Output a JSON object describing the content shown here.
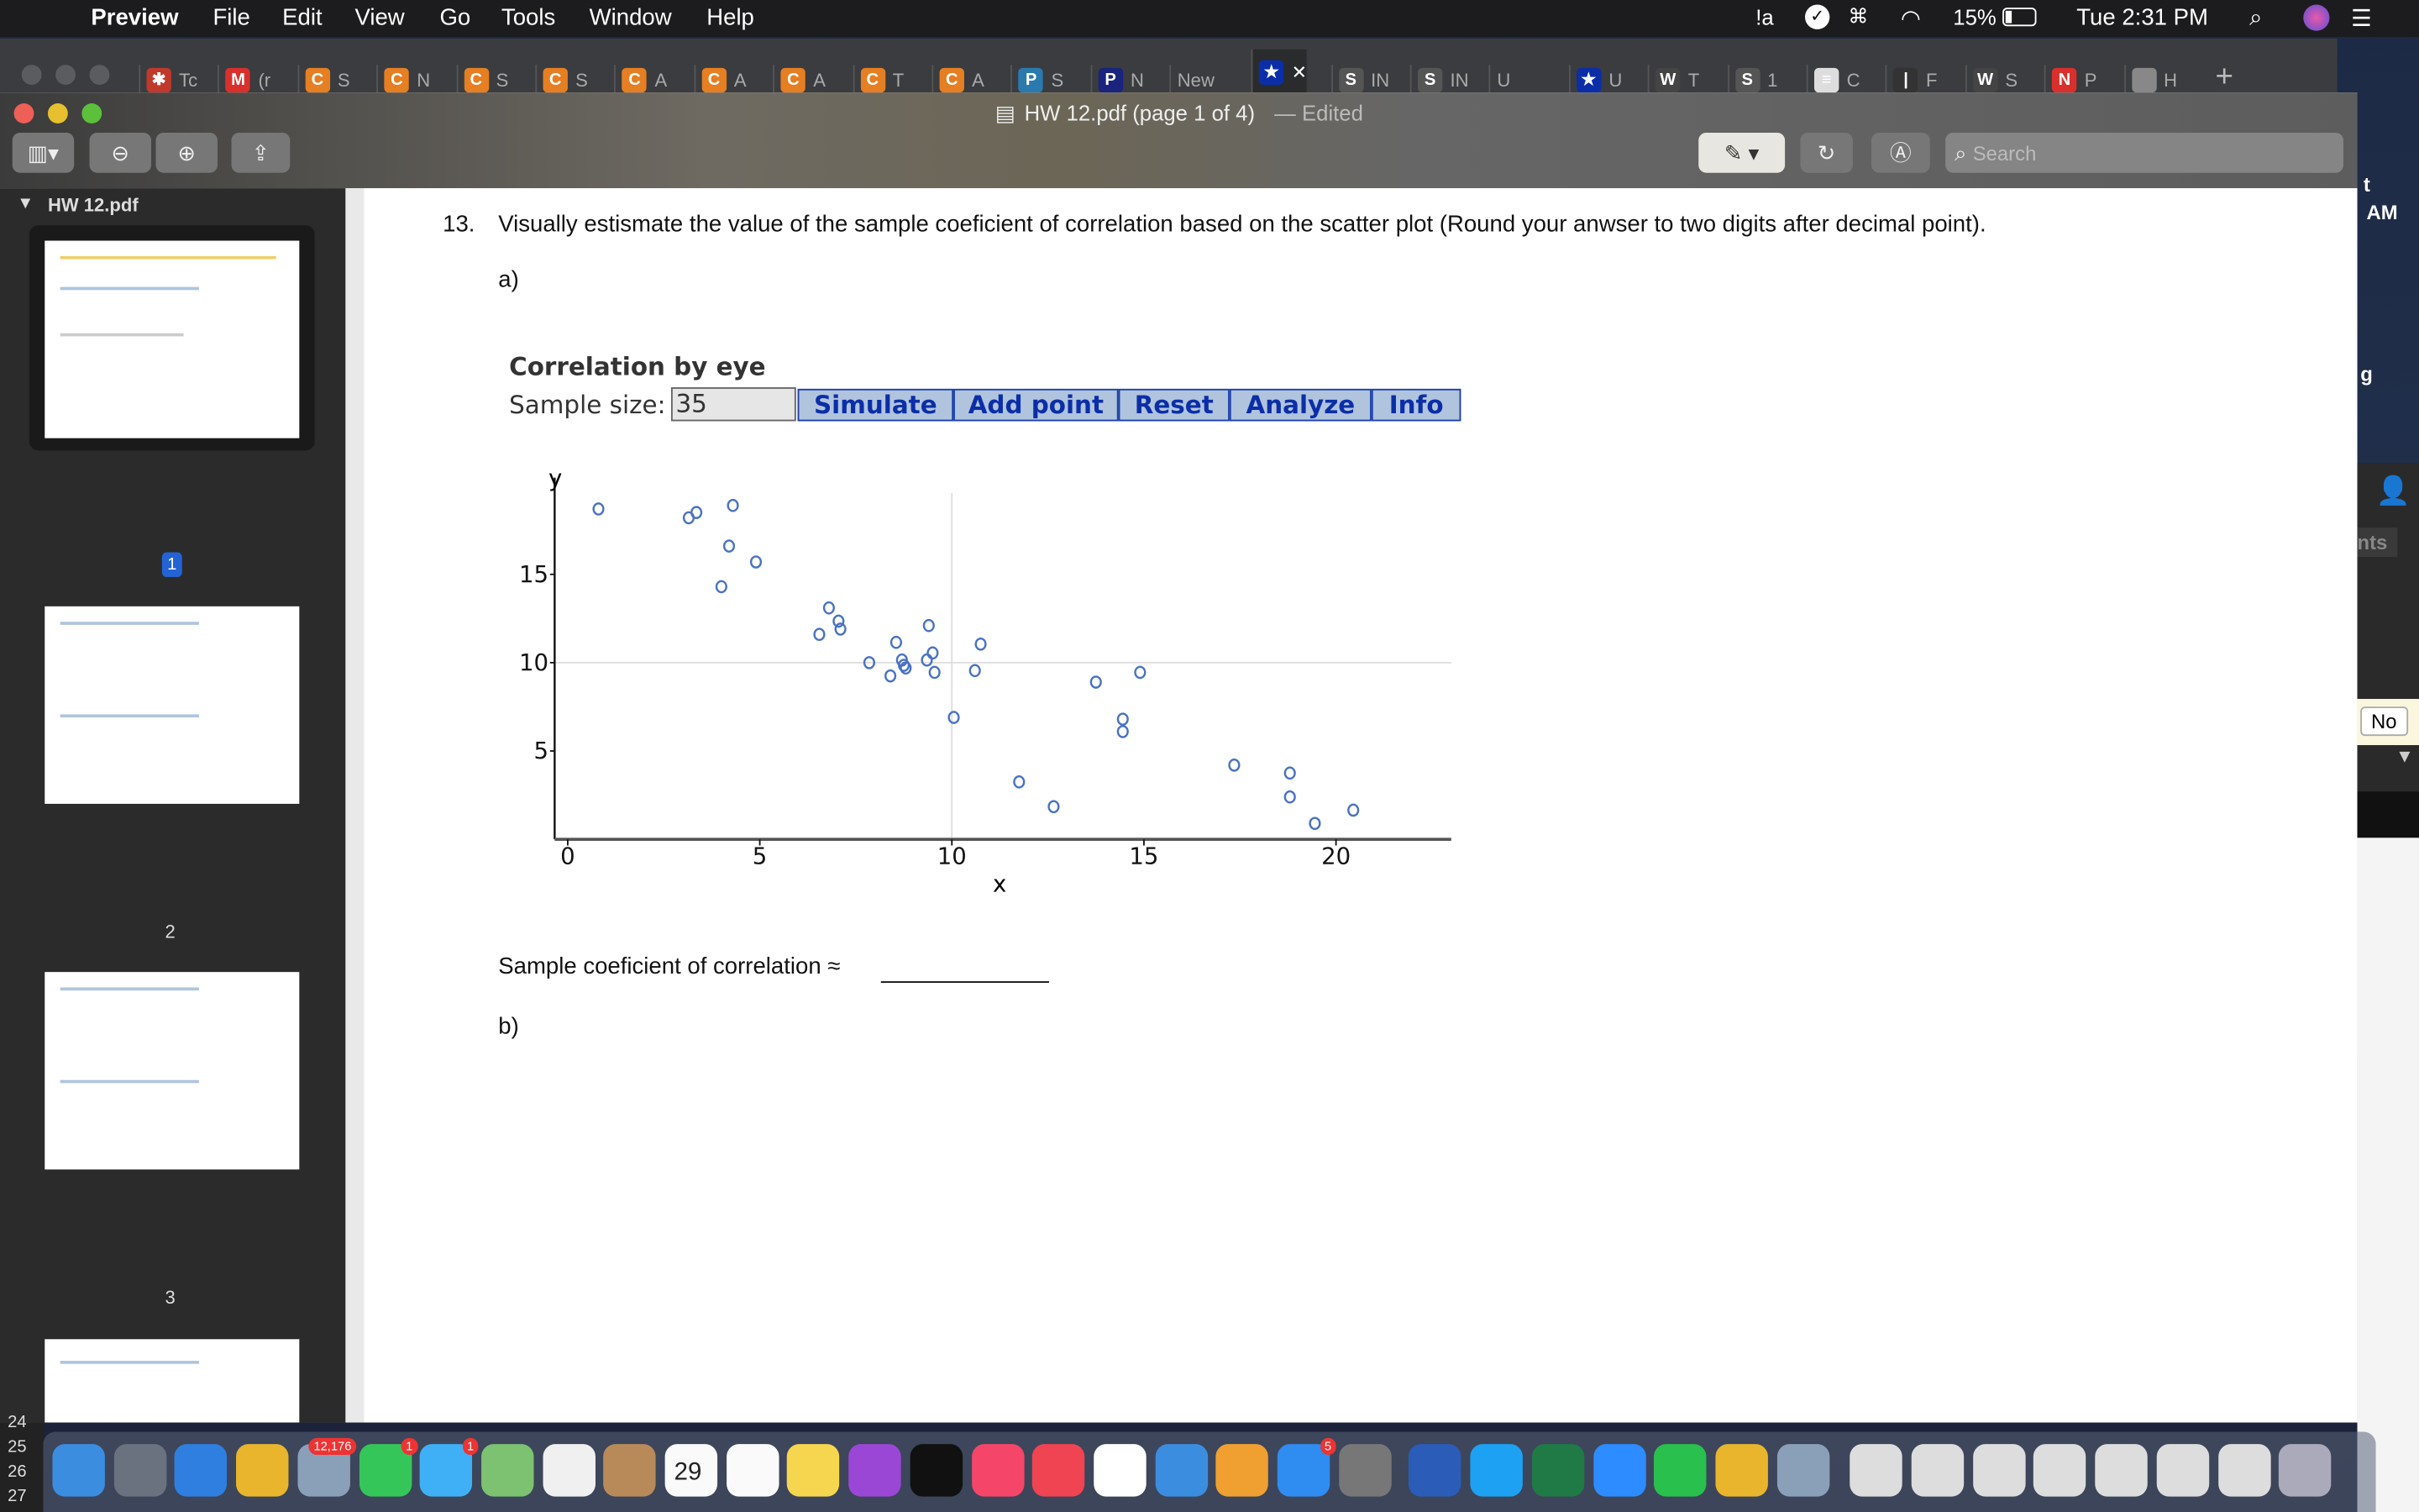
{
  "menubar": {
    "apple_icon": "apple-icon",
    "app": "Preview",
    "items": [
      "File",
      "Edit",
      "View",
      "Go",
      "Tools",
      "Window",
      "Help"
    ],
    "battery": "15%",
    "clock": "Tue 2:31 PM",
    "status_icons": [
      "avast-icon",
      "checkmark-icon",
      "command-icon",
      "wifi-icon",
      "battery-icon",
      "search-icon",
      "siri-icon",
      "list-icon"
    ]
  },
  "tabs": [
    {
      "label": "Tc",
      "color": "#c0392b",
      "glyph": "✱"
    },
    {
      "label": "(r",
      "color": "#d9302c",
      "glyph": "M"
    },
    {
      "label": "S",
      "color": "#e67e22",
      "glyph": "C"
    },
    {
      "label": "N",
      "color": "#e67e22",
      "glyph": "C"
    },
    {
      "label": "S",
      "color": "#e67e22",
      "glyph": "C"
    },
    {
      "label": "S",
      "color": "#e67e22",
      "glyph": "C"
    },
    {
      "label": "A",
      "color": "#e67e22",
      "glyph": "C"
    },
    {
      "label": "A",
      "color": "#e67e22",
      "glyph": "C"
    },
    {
      "label": "A",
      "color": "#e67e22",
      "glyph": "C"
    },
    {
      "label": "T",
      "color": "#e67e22",
      "glyph": "C"
    },
    {
      "label": "A",
      "color": "#e67e22",
      "glyph": "C"
    },
    {
      "label": "S",
      "color": "#2a7ab0",
      "glyph": "P"
    },
    {
      "label": "N",
      "color": "#1a237e",
      "glyph": "P"
    },
    {
      "label": "New",
      "color": "",
      "glyph": ""
    },
    {
      "label": "✕",
      "color": "#0b2ea8",
      "glyph": "★",
      "active": true
    },
    {
      "label": "IN",
      "color": "#555",
      "glyph": "S"
    },
    {
      "label": "IN",
      "color": "#555",
      "glyph": "S"
    },
    {
      "label": "U",
      "color": "",
      "glyph": ""
    },
    {
      "label": "U",
      "color": "#0b2ea8",
      "glyph": "★"
    },
    {
      "label": "T",
      "color": "#444",
      "glyph": "W"
    },
    {
      "label": "1",
      "color": "#555",
      "glyph": "S"
    },
    {
      "label": "C",
      "color": "#ddd",
      "glyph": "≡"
    },
    {
      "label": "F",
      "color": "#333",
      "glyph": "|"
    },
    {
      "label": "S",
      "color": "#444",
      "glyph": "W"
    },
    {
      "label": "P",
      "color": "#d9302c",
      "glyph": "N"
    },
    {
      "label": "H",
      "color": "#888",
      "glyph": ""
    }
  ],
  "window": {
    "title": "HW 12.pdf (page 1 of 4)",
    "edited": "— Edited",
    "search_placeholder": "Search"
  },
  "sidebar": {
    "file": "HW 12.pdf",
    "pages": [
      "1",
      "2",
      "3"
    ]
  },
  "doc": {
    "q_number": "13.",
    "question": "Visually estismate the value of the sample coeficient of correlation based on the scatter plot (Round your anwser to two digits after decimal point).",
    "part_a": "a)",
    "part_b": "b)",
    "widget_title": "Correlation by eye",
    "sample_label": "Sample size:",
    "sample_value": "35",
    "buttons": [
      "Simulate",
      "Add point",
      "Reset",
      "Analyze",
      "Info"
    ],
    "answer_label": "Sample coeficient of correlation ≈"
  },
  "chart_data": {
    "type": "scatter",
    "xlabel": "x",
    "ylabel": "y",
    "xticks": [
      0,
      5,
      10,
      15,
      20
    ],
    "yticks": [
      5,
      10,
      15
    ],
    "xlim": [
      -0.3,
      23
    ],
    "ylim": [
      0,
      19.6
    ],
    "reference_lines": {
      "x": 10,
      "y": 10
    },
    "marker": "open-circle",
    "color": "#4a72c4",
    "points": [
      [
        0.8,
        18.7
      ],
      [
        3.15,
        18.2
      ],
      [
        3.35,
        18.5
      ],
      [
        4.3,
        18.9
      ],
      [
        4.2,
        16.6
      ],
      [
        4.9,
        15.7
      ],
      [
        4.0,
        14.3
      ],
      [
        6.8,
        13.1
      ],
      [
        7.05,
        12.35
      ],
      [
        7.1,
        11.9
      ],
      [
        6.55,
        11.6
      ],
      [
        8.55,
        11.15
      ],
      [
        9.4,
        12.1
      ],
      [
        10.75,
        11.05
      ],
      [
        7.85,
        10.0
      ],
      [
        8.7,
        10.15
      ],
      [
        8.75,
        9.85
      ],
      [
        8.8,
        9.7
      ],
      [
        9.35,
        10.15
      ],
      [
        9.5,
        10.55
      ],
      [
        8.4,
        9.25
      ],
      [
        9.55,
        9.45
      ],
      [
        10.6,
        9.55
      ],
      [
        10.05,
        6.9
      ],
      [
        13.75,
        8.9
      ],
      [
        14.9,
        9.45
      ],
      [
        14.45,
        6.8
      ],
      [
        14.45,
        6.1
      ],
      [
        11.75,
        3.25
      ],
      [
        12.65,
        1.85
      ],
      [
        17.35,
        4.2
      ],
      [
        18.8,
        3.75
      ],
      [
        18.8,
        2.4
      ],
      [
        19.45,
        0.9
      ],
      [
        20.45,
        1.65
      ]
    ]
  },
  "right_edge": {
    "texts": [
      "t",
      "AM",
      "g",
      "nts",
      "No"
    ]
  },
  "sheet_rows": [
    "24",
    "25",
    "26",
    "27"
  ],
  "dock": [
    {
      "name": "finder",
      "color": "#3b8de0"
    },
    {
      "name": "launchpad",
      "color": "#6a7280"
    },
    {
      "name": "safari",
      "color": "#2f7fe0"
    },
    {
      "name": "chrome",
      "color": "#e8b52c"
    },
    {
      "name": "preview",
      "color": "#8aa0b8",
      "badge": "12,176"
    },
    {
      "name": "facetime",
      "color": "#35c659",
      "badge": "1"
    },
    {
      "name": "messages",
      "color": "#3fb0f5",
      "badge": "1"
    },
    {
      "name": "maps",
      "color": "#7cc270"
    },
    {
      "name": "photos",
      "color": "#f0f0f0"
    },
    {
      "name": "contacts",
      "color": "#b88a5a"
    },
    {
      "name": "calendar",
      "color": "#fafafa",
      "text": "29"
    },
    {
      "name": "reminders",
      "color": "#fafafa"
    },
    {
      "name": "notes",
      "color": "#f6d64e"
    },
    {
      "name": "podcasts",
      "color": "#9b47d6"
    },
    {
      "name": "tv",
      "color": "#111"
    },
    {
      "name": "music",
      "color": "#f5466a"
    },
    {
      "name": "news",
      "color": "#f04452"
    },
    {
      "name": "numbers",
      "color": "#fff"
    },
    {
      "name": "keynote",
      "color": "#3b8de0"
    },
    {
      "name": "pages",
      "color": "#f0a030"
    },
    {
      "name": "app-store",
      "color": "#2f8cf0",
      "badge": "5"
    },
    {
      "name": "system-preferences",
      "color": "#777"
    },
    {
      "name": "word",
      "color": "#2b5cb8"
    },
    {
      "name": "skype",
      "color": "#1da1f2"
    },
    {
      "name": "excel",
      "color": "#1f7a45"
    },
    {
      "name": "zoom",
      "color": "#2d8cff"
    },
    {
      "name": "whatsapp",
      "color": "#29c04d"
    },
    {
      "name": "chrome-2",
      "color": "#e8b52c"
    },
    {
      "name": "preview-2",
      "color": "#8aa0b8"
    },
    {
      "name": "window-1",
      "color": "#ddd"
    },
    {
      "name": "window-2",
      "color": "#ddd"
    },
    {
      "name": "window-3",
      "color": "#ddd"
    },
    {
      "name": "window-4",
      "color": "#ddd"
    },
    {
      "name": "window-5",
      "color": "#ddd"
    },
    {
      "name": "window-6",
      "color": "#ddd"
    },
    {
      "name": "window-7",
      "color": "#ddd"
    },
    {
      "name": "trash",
      "color": "#aab"
    }
  ]
}
